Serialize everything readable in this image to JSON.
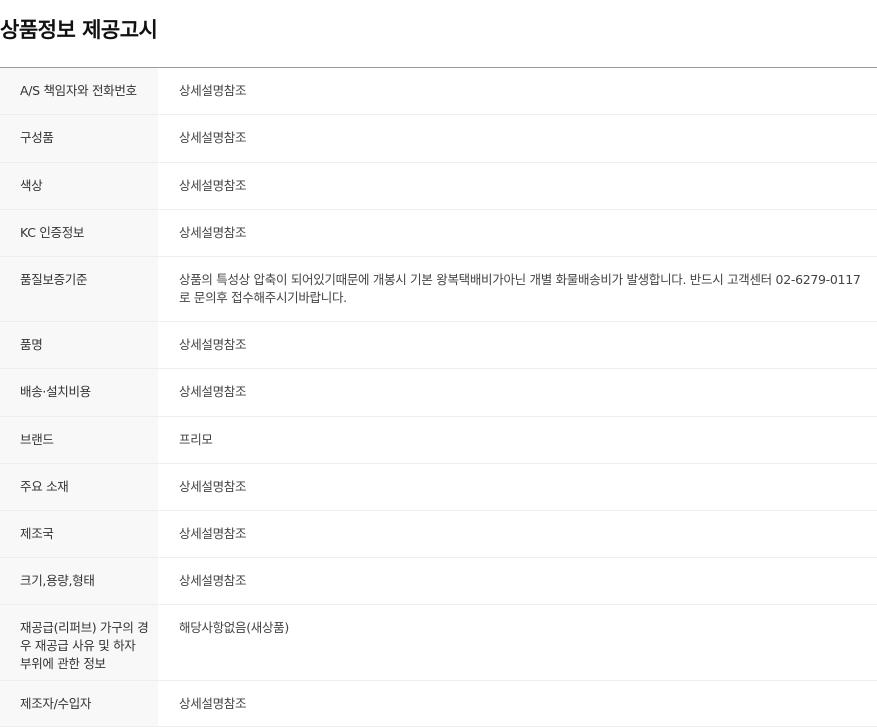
{
  "page": {
    "title": "상품정보 제공고시"
  },
  "rows": [
    {
      "label": "A/S 책임자와 전화번호",
      "value": "상세설명참조"
    },
    {
      "label": "구성품",
      "value": "상세설명참조"
    },
    {
      "label": "색상",
      "value": "상세설명참조"
    },
    {
      "label": "KC 인증정보",
      "value": "상세설명참조"
    },
    {
      "label": "품질보증기준",
      "value": "상품의 특성상 압축이 되어있기때문에 개봉시 기본 왕복택배비가아닌 개별 화물배송비가 발생합니다. 반드시 고객센터 02-6279-0117로 문의후 접수해주시기바랍니다."
    },
    {
      "label": "품명",
      "value": "상세설명참조"
    },
    {
      "label": "배송·설치비용",
      "value": "상세설명참조"
    },
    {
      "label": "브랜드",
      "value": "프리모"
    },
    {
      "label": "주요 소재",
      "value": "상세설명참조"
    },
    {
      "label": "제조국",
      "value": "상세설명참조"
    },
    {
      "label": "크기,용량,형태",
      "value": "상세설명참조"
    },
    {
      "label": "재공급(리퍼브) 가구의 경우 재공급 사유 및 하자 부위에 관한 정보",
      "value": "해당사항없음(새상품)"
    },
    {
      "label": "제조자/수입자",
      "value": "상세설명참조"
    }
  ]
}
